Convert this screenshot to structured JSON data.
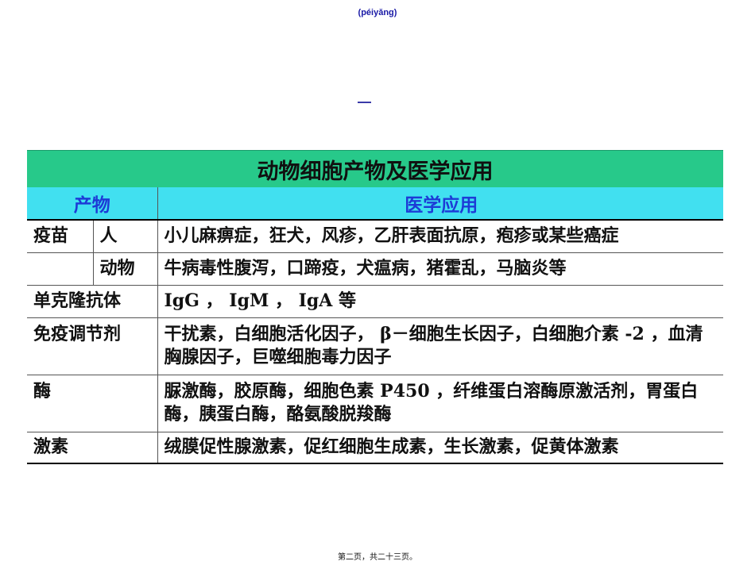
{
  "header_note": "(péiyǎng)",
  "table": {
    "title": "动物细胞产物及医学应用",
    "col_headers": [
      "产物",
      "医学应用"
    ],
    "rows": [
      {
        "product_main": "疫苗",
        "product_sub": "人",
        "application": "小儿麻痹症，狂犬，风疹，乙肝表面抗原，疱疹或某些癌症"
      },
      {
        "product_main": "",
        "product_sub": "动物",
        "application": "牛病毒性腹泻，口蹄疫，犬瘟病，猪霍乱，马脑炎等"
      },
      {
        "product_main": "单克隆抗体",
        "product_sub": "",
        "application": "IgG ， IgM ， IgA 等"
      },
      {
        "product_main": "免疫调节剂",
        "product_sub": "",
        "application": "干扰素，白细胞活化因子， β－细胞生长因子，白细胞介素 -2 ，血清胸腺因子，巨噬细胞毒力因子"
      },
      {
        "product_main": "酶",
        "product_sub": "",
        "application": "脲激酶，胶原酶，细胞色素 P450 ，纤维蛋白溶酶原激活剂，胃蛋白酶，胰蛋白酶，酪氨酸脱羧酶"
      },
      {
        "product_main": "激素",
        "product_sub": "",
        "application": "绒膜促性腺激素，促红细胞生成素，生长激素，促黄体激素"
      }
    ]
  },
  "footer_note": "第二页，共二十三页。"
}
